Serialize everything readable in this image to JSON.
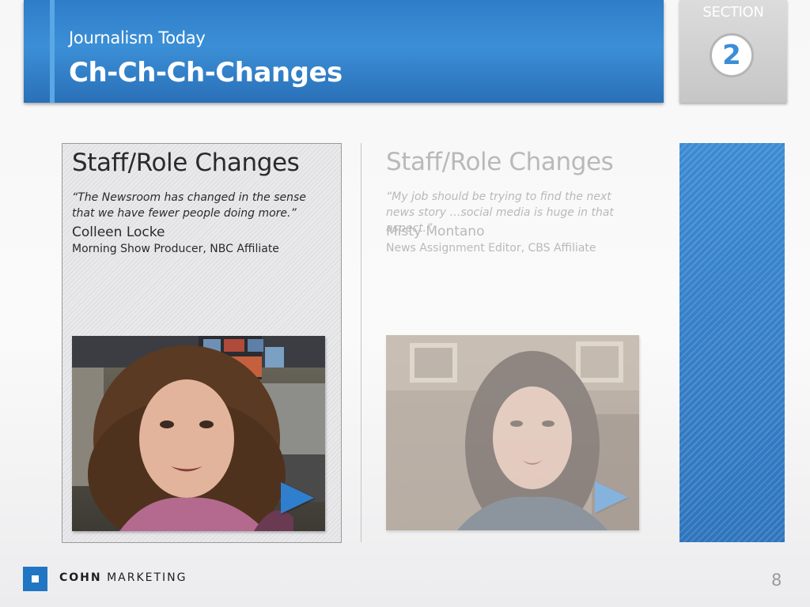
{
  "header": {
    "subtitle": "Journalism Today",
    "title": "Ch-Ch-Ch-Changes",
    "accent_color": "#3a8ed6"
  },
  "section": {
    "label": "SECTION",
    "number": "2"
  },
  "panels": [
    {
      "title": "Staff/Role Changes",
      "quote": "“The Newsroom has changed in the sense that we have fewer people doing more.”",
      "name": "Colleen Locke",
      "role": "Morning Show Producer, NBC Affiliate",
      "video_icon": "play-icon",
      "state": "active"
    },
    {
      "title": "Staff/Role Changes",
      "quote": "“My job should be trying to find the next news story …social media is huge in that aspect.”",
      "name": "Misty Montano",
      "role": "News Assignment Editor, CBS Affiliate",
      "video_icon": "play-icon",
      "state": "faded"
    }
  ],
  "footer": {
    "brand_bold": "COHN",
    "brand_rest": "MARKETING",
    "page_number": "8"
  }
}
